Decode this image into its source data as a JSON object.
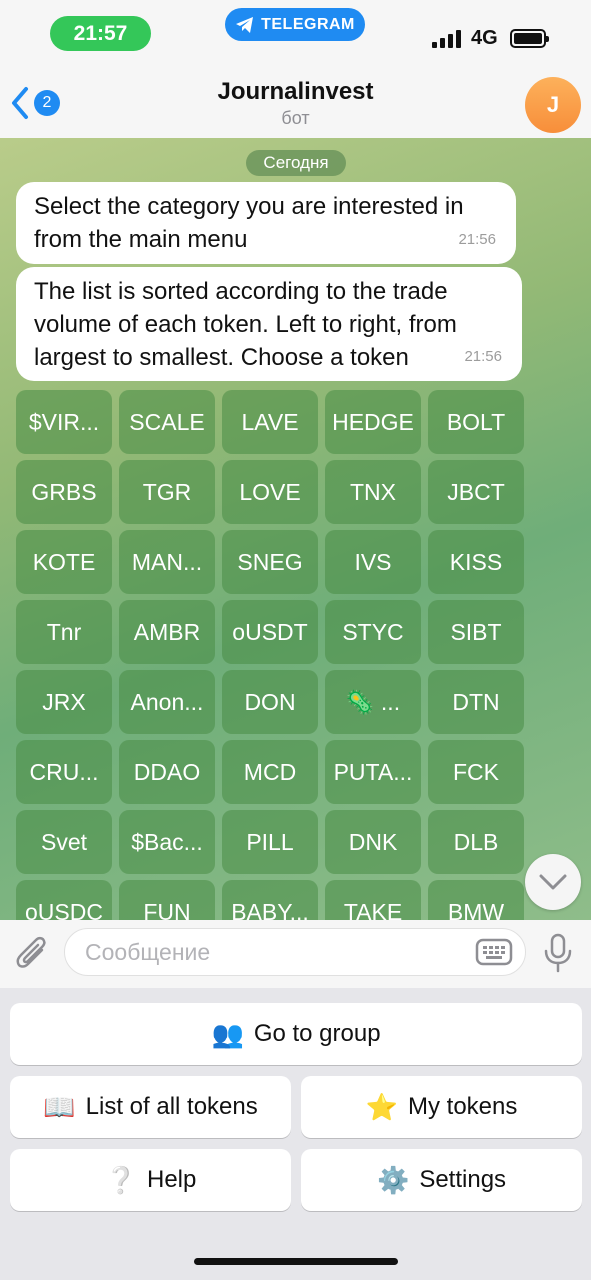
{
  "status_bar": {
    "time": "21:57",
    "app_pill": "TELEGRAM",
    "network": "4G"
  },
  "header": {
    "back_badge": "2",
    "title": "Journalinvest",
    "subtitle": "бот",
    "avatar_letter": "J"
  },
  "chat": {
    "date_chip": "Сегодня",
    "messages": [
      {
        "text": "Select the category you are interested in from the main menu",
        "time": "21:56"
      },
      {
        "text": "The list is sorted according to the trade volume of each token. Left to right, from largest to smallest. Choose a token",
        "time": "21:56"
      }
    ],
    "tokens": [
      "$VIR...",
      "SCALE",
      "LAVE",
      "HEDGE",
      "BOLT",
      "GRBS",
      "TGR",
      "LOVE",
      "TNX",
      "JBCT",
      "KOTE",
      "MAN...",
      "SNEG",
      "IVS",
      "KISS",
      "Tnr",
      "AMBR",
      "oUSDT",
      "STYC",
      "SIBT",
      "JRX",
      "Anon...",
      "DON",
      "🦠 ...",
      "DTN",
      "CRU...",
      "DDAO",
      "MCD",
      "PUTA...",
      "FCK",
      "Svet",
      "$Bac...",
      "PILL",
      "DNK",
      "DLB",
      "oUSDC",
      "FUN",
      "BABY...",
      "TAKE",
      "BMW"
    ]
  },
  "input": {
    "placeholder": "Сообщение"
  },
  "reply_keyboard": {
    "go_to_group": {
      "emoji": "👥",
      "label": "Go to group"
    },
    "list_all_tokens": {
      "emoji": "📖",
      "label": "List of all tokens"
    },
    "my_tokens": {
      "emoji": "⭐",
      "label": "My tokens"
    },
    "help": {
      "emoji": "❔",
      "label": "Help"
    },
    "settings": {
      "emoji": "⚙️",
      "label": "Settings"
    }
  },
  "colors": {
    "accent": "#1f8bf2",
    "time_pill": "#34c759",
    "token_button": "#4f9a55",
    "avatar": "#f89a42"
  }
}
